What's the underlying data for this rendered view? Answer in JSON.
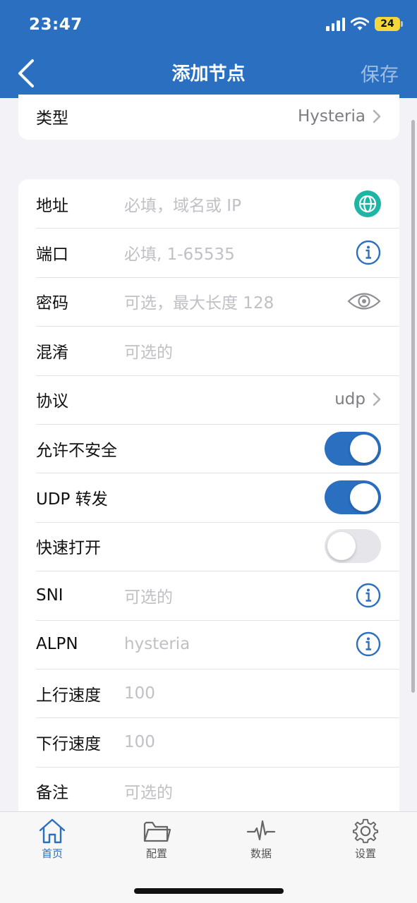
{
  "status_bar": {
    "time": "23:47",
    "battery": "24"
  },
  "nav": {
    "title": "添加节点",
    "save_label": "保存"
  },
  "type_row": {
    "label": "类型",
    "value": "Hysteria"
  },
  "fields": {
    "address": {
      "label": "地址",
      "placeholder": "必填，域名或 IP"
    },
    "port": {
      "label": "端口",
      "placeholder": "必填, 1-65535"
    },
    "password": {
      "label": "密码",
      "placeholder": "可选，最大长度 128"
    },
    "obfs": {
      "label": "混淆",
      "placeholder": "可选的"
    },
    "protocol": {
      "label": "协议",
      "value": "udp"
    },
    "allow_insecure": {
      "label": "允许不安全",
      "on": true
    },
    "udp_relay": {
      "label": "UDP 转发",
      "on": true
    },
    "fast_open": {
      "label": "快速打开",
      "on": false
    },
    "sni": {
      "label": "SNI",
      "placeholder": "可选的"
    },
    "alpn": {
      "label": "ALPN",
      "placeholder": "hysteria"
    },
    "upload_speed": {
      "label": "上行速度",
      "placeholder": "100"
    },
    "download_speed": {
      "label": "下行速度",
      "placeholder": "100"
    },
    "remark": {
      "label": "备注",
      "placeholder": "可选的"
    }
  },
  "tabs": [
    {
      "label": "首页",
      "icon": "home-icon",
      "active": true
    },
    {
      "label": "配置",
      "icon": "folder-icon",
      "active": false
    },
    {
      "label": "数据",
      "icon": "activity-icon",
      "active": false
    },
    {
      "label": "设置",
      "icon": "gear-icon",
      "active": false
    }
  ],
  "colors": {
    "accent": "#2a6fc0",
    "globe": "#1fb5a5",
    "battery": "#f5d63c"
  }
}
